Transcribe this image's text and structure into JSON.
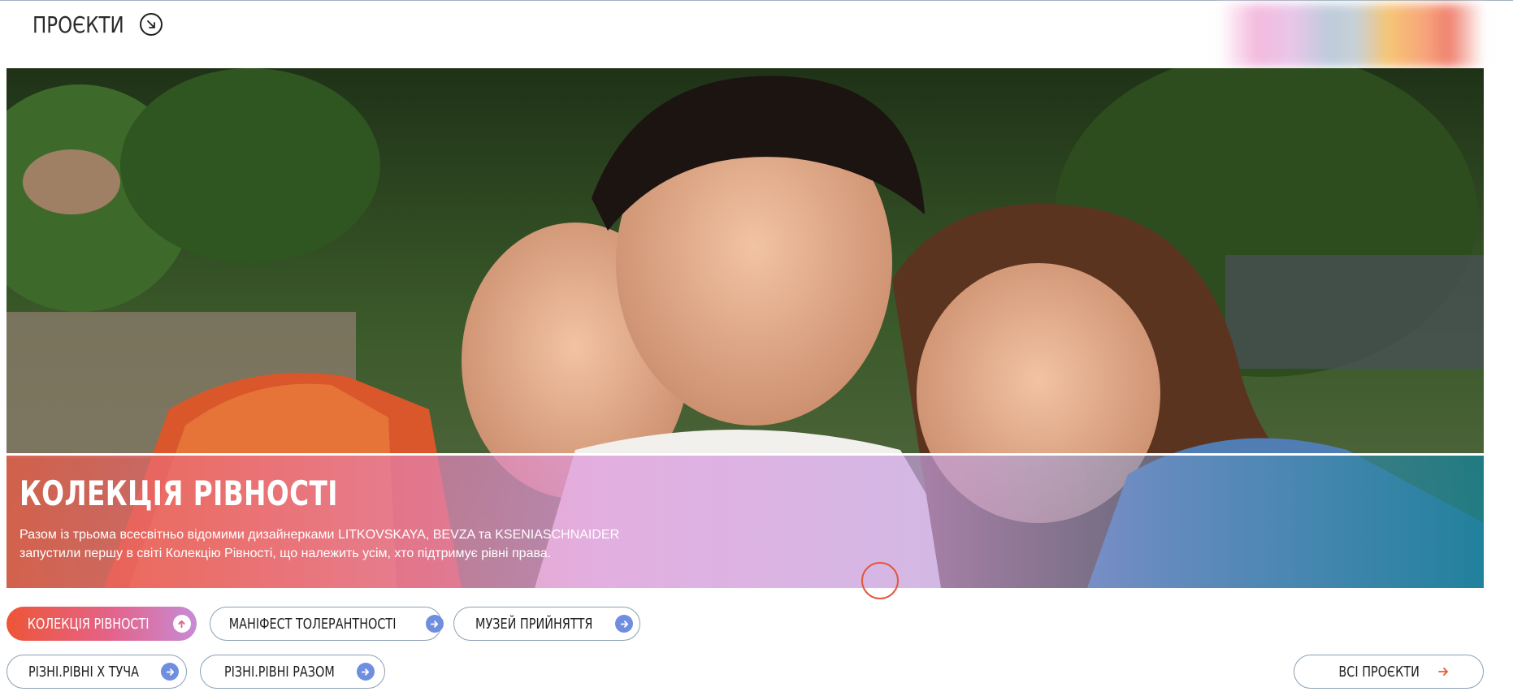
{
  "section": {
    "title": "ПРОЄКТИ",
    "arrow_icon": "arrow-down-right-circle-icon"
  },
  "hero": {
    "title": "КОЛЕКЦІЯ РІВНОСТІ",
    "text_line_1": "Разом із трьома всесвітньо відомими дизайнерками LITKOVSKAYA, BEVZA та KSENIASCHNAIDER",
    "text_line_2": "запустили першу в світі Колекцію Рівності, що належить усім, хто підтримує рівні права.",
    "image": "three people smiling photo"
  },
  "tabs": [
    {
      "label": "КОЛЕКЦІЯ РІВНОСТІ",
      "icon": "arrow-up-icon",
      "active": true
    },
    {
      "label": "МАНІФЕСТ ТОЛЕРАНТНОСТІ",
      "icon": "arrow-right-icon",
      "active": false
    },
    {
      "label": "МУЗЕЙ ПРИЙНЯТТЯ",
      "icon": "arrow-right-icon",
      "active": false
    },
    {
      "label": "РІЗНІ.РІВНІ Х ТУЧА",
      "icon": "arrow-right-icon",
      "active": false
    },
    {
      "label": "РІЗНІ.РІВНІ РАЗОМ",
      "icon": "arrow-right-icon",
      "active": false
    }
  ],
  "all_projects": {
    "label": "ВСІ ПРОЄКТИ",
    "icon": "arrow-right-icon"
  },
  "colors": {
    "accent_orange": "#ee5537",
    "accent_pink": "#e4638a",
    "accent_violet": "#c78bd6",
    "icon_blue": "#6f8ee0",
    "border": "#8aa0b4"
  }
}
